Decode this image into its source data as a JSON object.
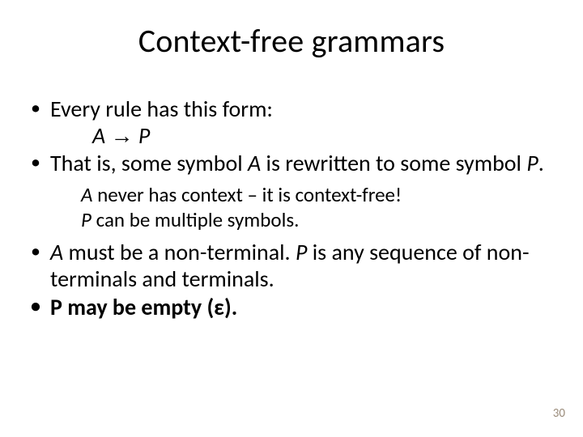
{
  "title": "Context-free grammars",
  "bullets": {
    "b1": "Every rule has this form:",
    "formula_A": "A",
    "formula_arrow": "→",
    "formula_P": "P",
    "b2_pre": "That is, some symbol ",
    "b2_A": "A",
    "b2_mid": " is rewritten to some symbol ",
    "b2_P": "P",
    "b2_post": ".",
    "sub1_A": "A",
    "sub1_rest": " never has context – it is context-free!",
    "sub2_P": "P",
    "sub2_rest": " can be multiple symbols.",
    "b3_space": " ",
    "b3_A": "A",
    "b3_mid1": " must be a non-terminal. ",
    "b3_P": "P",
    "b3_mid2": " is any sequence of non-terminals and terminals.",
    "b4": "P may be empty (ε)."
  },
  "page_number": "30"
}
